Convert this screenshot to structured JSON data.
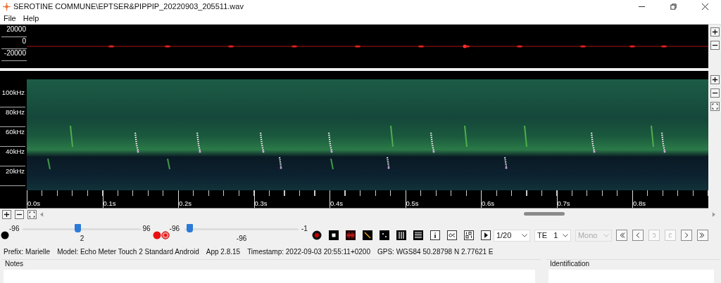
{
  "window": {
    "title": "SEROTINE COMMUNE\\EPTSER&PIPPIP_20220903_205511.wav"
  },
  "menu": [
    "File",
    "Help"
  ],
  "waveform": {
    "y_labels": [
      "20000",
      "0",
      "-20000"
    ]
  },
  "spectrogram": {
    "y_labels": [
      "100kHz",
      "80kHz",
      "60kHz",
      "40kHz",
      "20kHz"
    ],
    "time_labels": [
      "0.0s",
      "0.1s",
      "0.2s",
      "0.3s",
      "0.4s",
      "0.5s",
      "0.6s",
      "0.7s",
      "0.8s"
    ]
  },
  "sliders": [
    {
      "min": "-96",
      "max": "96",
      "value": "2",
      "level": 0.46
    },
    {
      "min": "-96",
      "max": "-1",
      "value": "-96",
      "level": 0.02
    }
  ],
  "selects": [
    {
      "value": "1/20",
      "disabled": false
    },
    {
      "value": "TE   1",
      "disabled": false
    },
    {
      "value": "Mono",
      "disabled": true
    }
  ],
  "nav_buttons": [
    {
      "kind": "first",
      "disabled": false
    },
    {
      "kind": "prev",
      "disabled": false
    },
    {
      "kind": "undo",
      "disabled": true
    },
    {
      "kind": "redo",
      "disabled": true
    },
    {
      "kind": "next",
      "disabled": false
    },
    {
      "kind": "last",
      "disabled": false
    }
  ],
  "info": [
    "Prefix: Marielle",
    "Model: Echo Meter Touch 2 Standard Android",
    "App 2.8.15",
    "Timestamp: 2022-09-03 20:55:11+0200",
    "GPS: WGS84 50.28798 N 2.77621 E"
  ],
  "groups": [
    "Notes",
    "Identification"
  ]
}
